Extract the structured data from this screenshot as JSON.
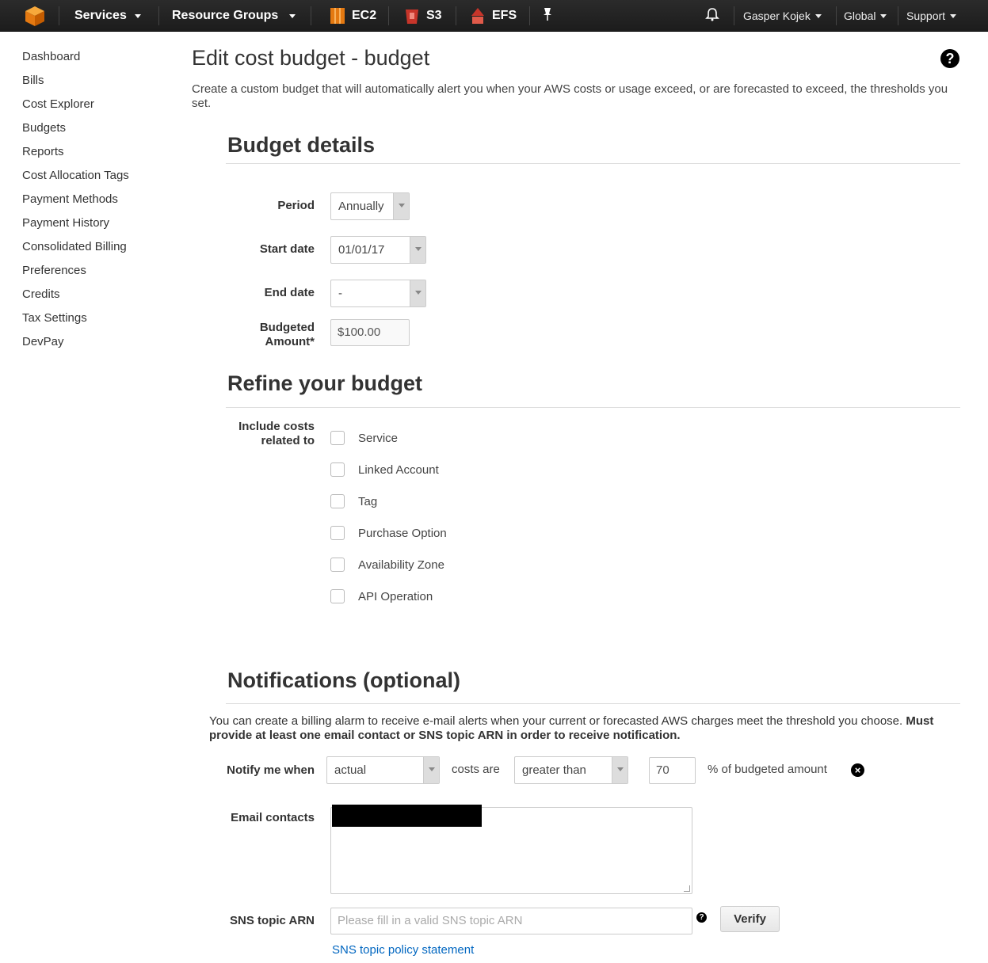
{
  "nav": {
    "services": "Services",
    "resource_groups": "Resource Groups",
    "ec2": "EC2",
    "s3": "S3",
    "efs": "EFS",
    "user": "Gasper Kojek",
    "region": "Global",
    "support": "Support"
  },
  "sidebar": {
    "items": [
      "Dashboard",
      "Bills",
      "Cost Explorer",
      "Budgets",
      "Reports",
      "Cost Allocation Tags",
      "Payment Methods",
      "Payment History",
      "Consolidated Billing",
      "Preferences",
      "Credits",
      "Tax Settings",
      "DevPay"
    ]
  },
  "page": {
    "title": "Edit cost budget - budget",
    "intro": "Create a custom budget that will automatically alert you when your AWS costs or usage exceed, or are forecasted to exceed, the thresholds you set."
  },
  "budget_details": {
    "title": "Budget details",
    "period_label": "Period",
    "period_value": "Annually",
    "start_label": "Start date",
    "start_value": "01/01/17",
    "end_label": "End date",
    "end_value": "-",
    "amount_label_1": "Budgeted",
    "amount_label_2": "Amount*",
    "amount_value": "$100.00"
  },
  "refine": {
    "title": "Refine your budget",
    "include_label_1": "Include costs",
    "include_label_2": "related to",
    "options": [
      "Service",
      "Linked Account",
      "Tag",
      "Purchase Option",
      "Availability Zone",
      "API Operation"
    ]
  },
  "notifications": {
    "title": "Notifications (optional)",
    "desc_plain": "You can create a billing alarm to receive e-mail alerts when your current or forecasted AWS charges meet the threshold you choose. ",
    "desc_bold": "Must provide at least one email contact or SNS topic ARN in order to receive notification.",
    "notify_label": "Notify me when",
    "type_value": "actual",
    "costs_are": "costs are",
    "comparison_value": "greater than",
    "threshold_value": "70",
    "threshold_suffix": "% of budgeted amount",
    "email_label": "Email contacts",
    "sns_label": "SNS topic ARN",
    "sns_placeholder": "Please fill in a valid SNS topic ARN",
    "verify_label": "Verify",
    "policy_link": "SNS topic policy statement"
  }
}
